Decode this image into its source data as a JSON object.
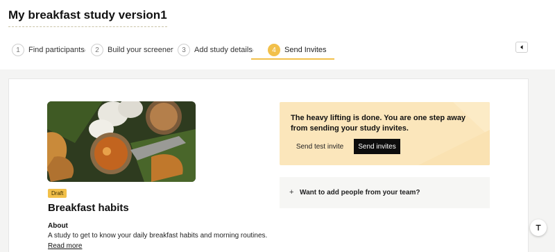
{
  "header": {
    "study_title": "My breakfast study version1"
  },
  "steps": [
    {
      "number": "1",
      "label": "Find participants"
    },
    {
      "number": "2",
      "label": "Build your screener"
    },
    {
      "number": "3",
      "label": "Add study details"
    },
    {
      "number": "4",
      "label": "Send Invites"
    }
  ],
  "active_step": 4,
  "study": {
    "status_badge": "Draft",
    "name": "Breakfast habits",
    "about_heading": "About",
    "about_text": "A study to get to know your daily breakfast habits and morning routines.",
    "read_more": "Read more"
  },
  "invite_panel": {
    "message": "The heavy lifting is done. You are one step away from sending your study invites.",
    "test_button": "Send test invite",
    "send_button": "Send invites"
  },
  "team_panel": {
    "icon": "plus-icon",
    "label": "Want to add people from your team?"
  },
  "icons": {
    "collapse": "caret-left-icon",
    "scroll_top": "scroll-to-top-icon"
  },
  "colors": {
    "accent": "#f2c04a",
    "cta_background": "#fbe6bb",
    "primary_button": "#0d0d0d"
  }
}
